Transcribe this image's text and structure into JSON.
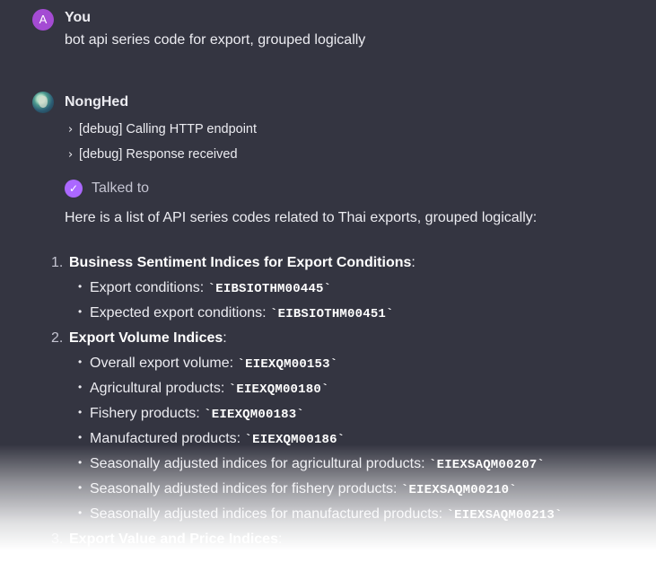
{
  "user_message": {
    "avatar_initial": "A",
    "author": "You",
    "text": "bot api series code for export, grouped logically"
  },
  "bot_message": {
    "author": "NongHed",
    "debug_lines": [
      "[debug] Calling HTTP endpoint",
      "[debug] Response received"
    ],
    "talked_to": "Talked to",
    "intro": "Here is a list of API series codes related to Thai exports, grouped logically:",
    "sections": [
      {
        "number": "1.",
        "title": "Business Sentiment Indices for Export Conditions",
        "items": [
          {
            "label": "Export conditions:",
            "code": "`EIBSIOTHM00445`"
          },
          {
            "label": "Expected export conditions:",
            "code": "`EIBSIOTHM00451`"
          }
        ]
      },
      {
        "number": "2.",
        "title": "Export Volume Indices",
        "items": [
          {
            "label": "Overall export volume:",
            "code": "`EIEXQM00153`"
          },
          {
            "label": "Agricultural products:",
            "code": "`EIEXQM00180`"
          },
          {
            "label": "Fishery products:",
            "code": "`EIEXQM00183`"
          },
          {
            "label": "Manufactured products:",
            "code": "`EIEXQM00186`"
          },
          {
            "label": "Seasonally adjusted indices for agricultural products:",
            "code": "`EIEXSAQM00207`"
          },
          {
            "label": "Seasonally adjusted indices for fishery products:",
            "code": "`EIEXSAQM00210`"
          },
          {
            "label": "Seasonally adjusted indices for manufactured products:",
            "code": "`EIEXSAQM00213`"
          }
        ]
      },
      {
        "number": "3.",
        "title": "Export Value and Price Indices",
        "items": []
      }
    ]
  }
}
